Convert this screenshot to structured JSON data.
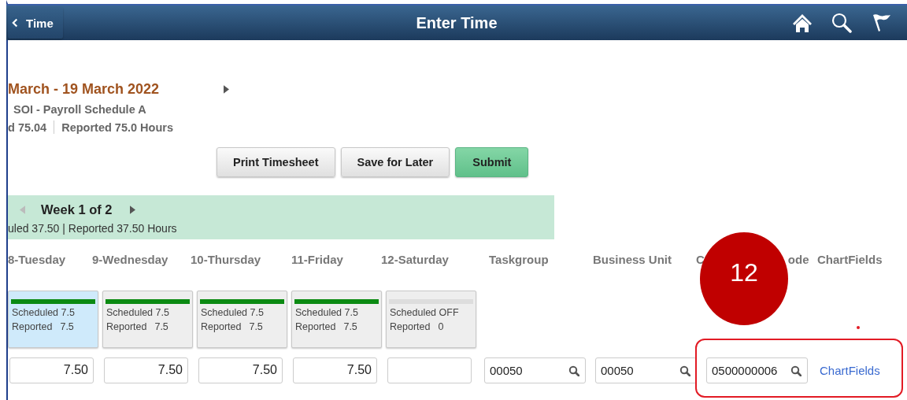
{
  "header": {
    "back_button": "Time",
    "title": "Enter Time"
  },
  "period": {
    "title": "March - 19 March 2022",
    "next_enabled": true,
    "schedule": "SOI - Payroll Schedule A",
    "scheduled": "d  75.04",
    "reported": "Reported  75.0 Hours"
  },
  "buttons": [
    {
      "label": "Print Timesheet",
      "kind": "default"
    },
    {
      "label": "Save for Later",
      "kind": "default"
    },
    {
      "label": "Submit",
      "kind": "primary"
    }
  ],
  "week": {
    "title": "Week 1 of 2",
    "previous_enabled": false,
    "next_enabled": true,
    "summary": "uled  37.50 | Reported  37.50 Hours"
  },
  "columns": [
    {
      "label": "8-Tuesday"
    },
    {
      "label": "9-Wednesday"
    },
    {
      "label": "10-Thursday"
    },
    {
      "label": "11-Friday"
    },
    {
      "label": "12-Saturday"
    },
    {
      "label": "Taskgroup"
    },
    {
      "label": "Business Unit"
    },
    {
      "label": "C",
      "label_end": "ode"
    },
    {
      "label": "ChartFields"
    }
  ],
  "days": [
    {
      "scheduled": "Scheduled 7.5",
      "reported_label": "Reported",
      "reported_value": "7.5",
      "has_schedule": true,
      "selected": true,
      "hours": "7.50"
    },
    {
      "scheduled": "Scheduled 7.5",
      "reported_label": "Reported",
      "reported_value": "7.5",
      "has_schedule": true,
      "selected": false,
      "hours": "7.50"
    },
    {
      "scheduled": "Scheduled 7.5",
      "reported_label": "Reported",
      "reported_value": "7.5",
      "has_schedule": true,
      "selected": false,
      "hours": "7.50"
    },
    {
      "scheduled": "Scheduled 7.5",
      "reported_label": "Reported",
      "reported_value": "7.5",
      "has_schedule": true,
      "selected": false,
      "hours": "7.50"
    },
    {
      "scheduled": "Scheduled OFF",
      "reported_label": "Reported",
      "reported_value": "0",
      "has_schedule": false,
      "selected": false
    }
  ],
  "lookups": [
    {
      "value": "00050"
    },
    {
      "value": "00050"
    },
    {
      "value": "0500000006"
    }
  ],
  "chartfields_link": "ChartFields",
  "annotation": {
    "step": "12"
  }
}
